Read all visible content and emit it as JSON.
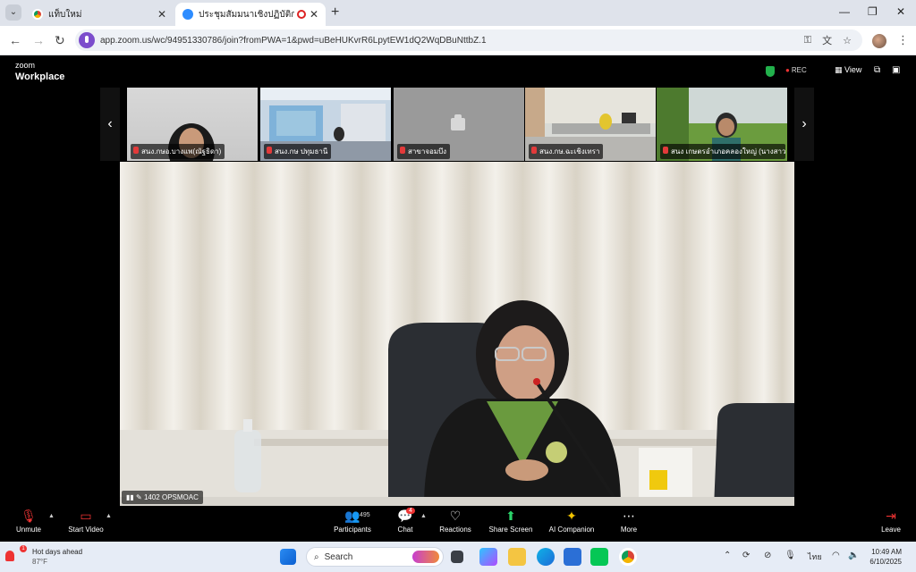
{
  "browser": {
    "tabs": [
      {
        "title": "แท็บใหม่",
        "active": false
      },
      {
        "title": "ประชุมสัมมนาเชิงปฏิบัติการ เรื่อง",
        "active": true
      }
    ],
    "url": "app.zoom.us/wc/94951330786/join?fromPWA=1&pwd=uBeHUKvrR6LpytEW1dQ2WqDBuNttbZ.1"
  },
  "zoom": {
    "brand_line1": "zoom",
    "brand_line2": "Workplace",
    "rec_label": "REC",
    "view_label": "View"
  },
  "filmstrip": [
    {
      "name": "สนง.กษอ.บางแพ(ณัฐธิดา)"
    },
    {
      "name": "สนง.กษ ปทุมธานี"
    },
    {
      "name": "สาขาจอมบึง"
    },
    {
      "name": "สนง.กษ.ฉะเชิงเทรา"
    },
    {
      "name": "สนง เกษตรอำเภอคลองใหญ่ (นางสาว"
    }
  ],
  "main_video": {
    "participant_name": "1402 OPSMOAC"
  },
  "toolbar": {
    "unmute": "Unmute",
    "start_video": "Start Video",
    "participants": "Participants",
    "participants_count": "495",
    "chat": "Chat",
    "chat_badge": "4",
    "reactions": "Reactions",
    "share_screen": "Share Screen",
    "ai_companion": "AI Companion",
    "more": "More",
    "leave": "Leave"
  },
  "taskbar": {
    "weather_title": "Hot days ahead",
    "weather_temp": "87°F",
    "weather_badge": "1",
    "search_placeholder": "Search",
    "language": "ไทย",
    "time": "10:49 AM",
    "date": "6/10/2025"
  }
}
